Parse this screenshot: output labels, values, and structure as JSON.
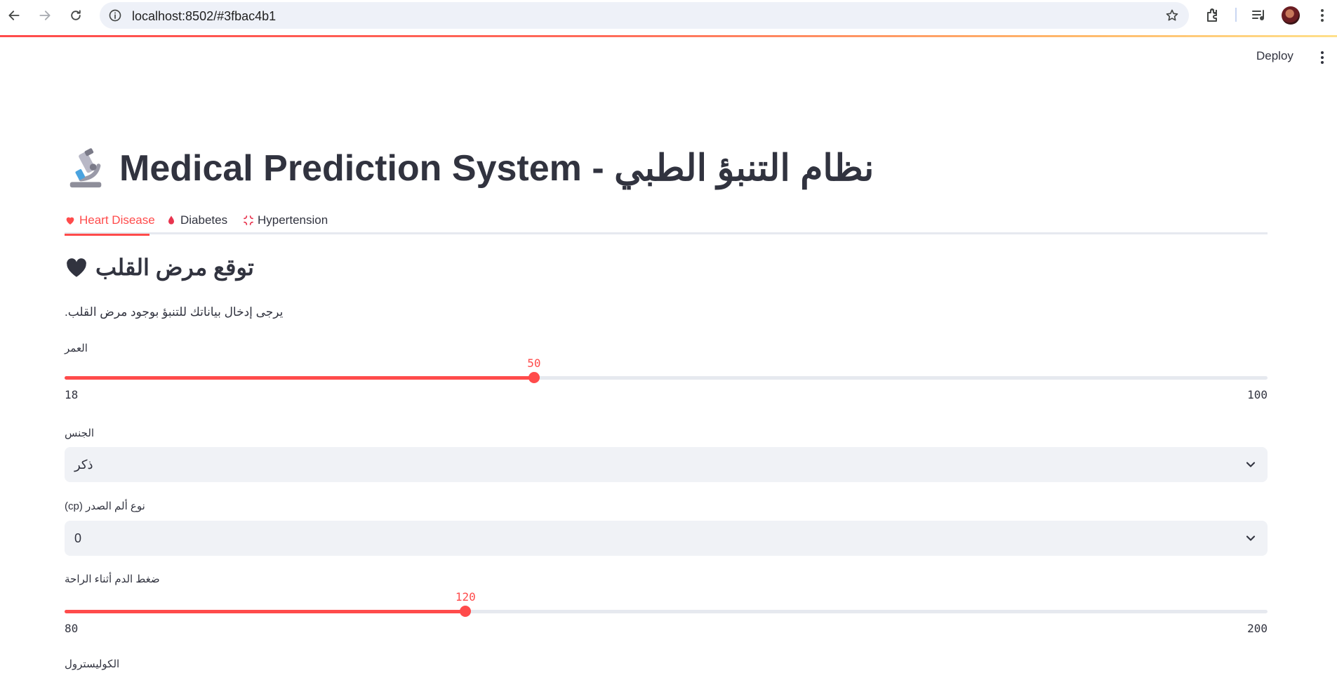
{
  "browser": {
    "url": "localhost:8502/#3fbac4b1"
  },
  "header": {
    "deploy_label": "Deploy"
  },
  "page": {
    "title": "Medical Prediction System - نظام التنبؤ الطبي",
    "title_icon": "microscope-icon"
  },
  "tabs": [
    {
      "label": "Heart Disease",
      "icon": "heart-icon",
      "active": true
    },
    {
      "label": "Diabetes",
      "icon": "drop-icon",
      "active": false
    },
    {
      "label": "Hypertension",
      "icon": "anger-icon",
      "active": false
    }
  ],
  "section": {
    "title": "توقع مرض القلب",
    "intro": "يرجى إدخال بياناتك للتنبؤ بوجود مرض القلب."
  },
  "form": {
    "age": {
      "label": "العمر",
      "value": 50,
      "min": 18,
      "max": 100
    },
    "sex": {
      "label": "الجنس",
      "value": "ذكر"
    },
    "cp": {
      "label": "نوع ألم الصدر (cp)",
      "value": "0"
    },
    "trestbps": {
      "label": "ضغط الدم أثناء الراحة",
      "value": 120,
      "min": 80,
      "max": 200
    },
    "chol": {
      "label": "الكوليسترول"
    }
  },
  "colors": {
    "accent": "#ff4b4b",
    "text": "#31333f",
    "track": "#e6e9ef",
    "input_bg": "#f0f2f6"
  }
}
